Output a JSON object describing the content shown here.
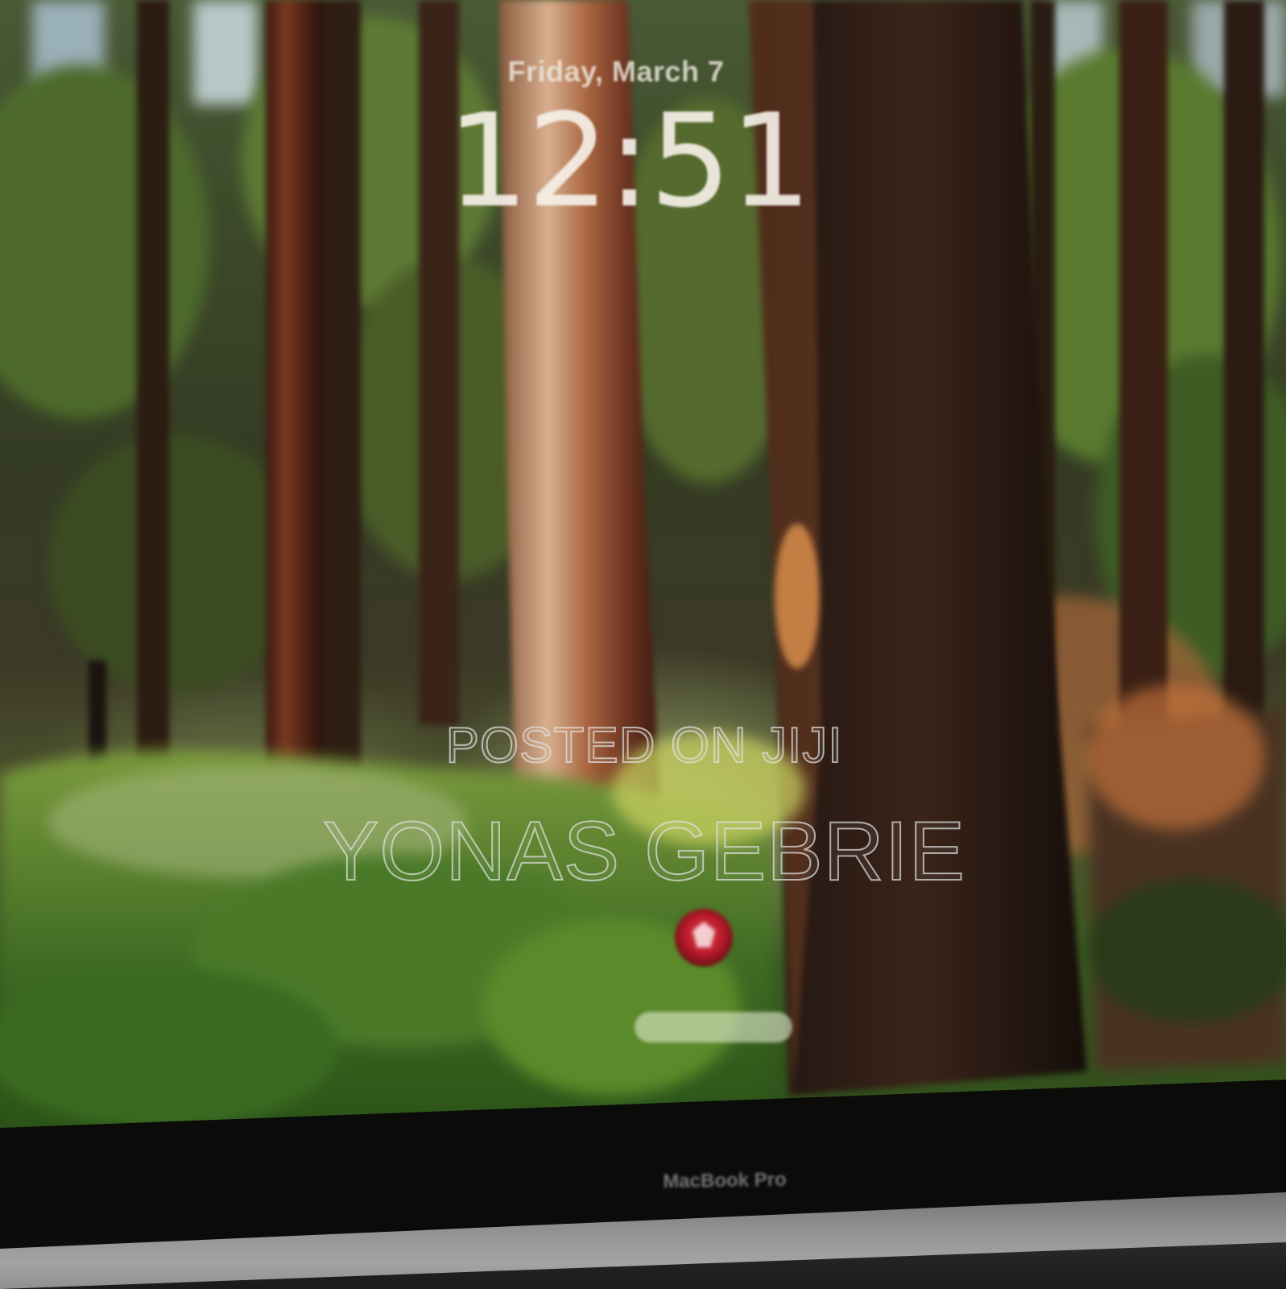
{
  "lock_screen": {
    "date": "Friday, March 7",
    "time": "12:51"
  },
  "watermark": {
    "line1": "POSTED ON JIJI",
    "line2": "YONAS GEBRIE"
  },
  "device": {
    "brand_label": "MacBook Pro"
  },
  "wallpaper": {
    "scene": "redwood forest"
  }
}
